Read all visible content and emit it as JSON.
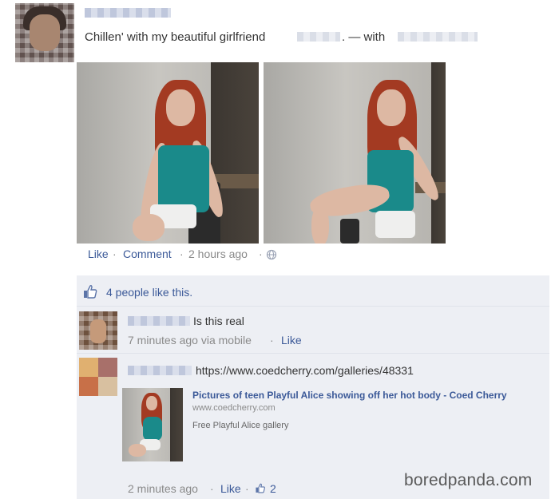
{
  "post": {
    "status_text": "Chillen' with my beautiful girlfriend",
    "status_sep": ". — with",
    "actions": {
      "like": "Like",
      "comment": "Comment",
      "time": "2 hours ago",
      "dot": "·"
    }
  },
  "likes": {
    "summary": "4 people like this."
  },
  "comments": [
    {
      "text": "Is this real",
      "meta": "7 minutes ago via mobile",
      "like": "Like"
    },
    {
      "url": "https://www.coedcherry.com/galleries/48331",
      "preview": {
        "title": "Pictures of teen Playful Alice showing off her hot body - Coed Cherry",
        "domain": "www.coedcherry.com",
        "description": "Free Playful Alice gallery"
      },
      "meta": "2 minutes ago",
      "like": "Like",
      "like_count": "2"
    }
  ],
  "watermark": "boredpanda.com",
  "colors": {
    "link": "#3b5998",
    "panel": "#edeff4",
    "muted": "#8a8a8a"
  },
  "icons": {
    "like": "thumbs-up-icon",
    "privacy": "globe-icon"
  }
}
